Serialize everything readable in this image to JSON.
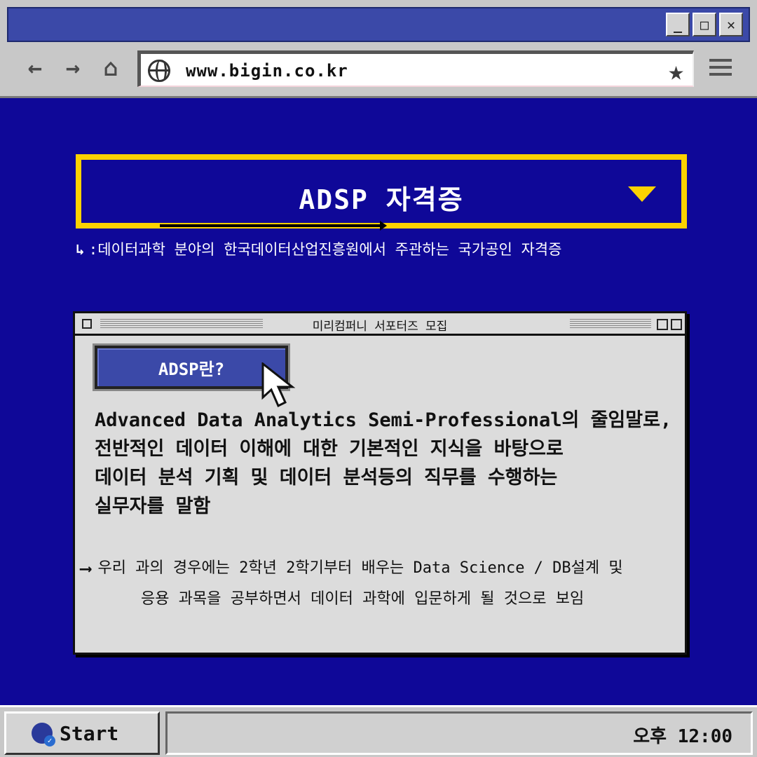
{
  "browser": {
    "url": "www.bigin.co.kr",
    "window_buttons": {
      "minimize": "_",
      "maximize": "□",
      "close": "✕"
    },
    "nav": {
      "back": "←",
      "forward": "→",
      "home": "⌂"
    },
    "star": "★"
  },
  "heading": {
    "title": "ADSP 자격증",
    "description": ":데이터과학 분야의 한국데이터산업진흥원에서 주관하는 국가공인 자격증",
    "elbow": "↳"
  },
  "panel": {
    "title": "미리컴퍼니 서포터즈 모집",
    "button_label": "ADSP란?",
    "body_lines": [
      "Advanced Data Analytics Semi-Professional의 줄임말로,",
      "전반적인 데이터 이해에 대한 기본적인 지식을 바탕으로",
      "데이터 분석 기획 및 데이터 분석등의 직무를 수행하는",
      "실무자를 말함"
    ],
    "note_arrow": "⟶",
    "note_line1": "우리 과의 경우에는 2학년 2학기부터 배우는 Data Science / DB설계 및",
    "note_line2": "응용 과목을 공부하면서 데이터 과학에 입문하게 될 것으로 보임"
  },
  "taskbar": {
    "start_label": "Start",
    "clock": "오후 12:00"
  },
  "colors": {
    "background": "#0f0898",
    "accent_yellow": "#fcd200",
    "titlebar_blue": "#3b49a8",
    "chrome_gray": "#c8c8c8"
  }
}
